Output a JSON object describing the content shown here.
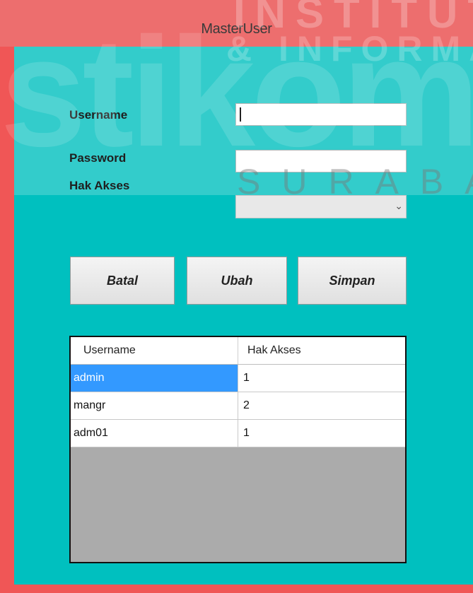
{
  "window": {
    "title": "MasterUser"
  },
  "watermark": {
    "brand": "stikom",
    "top": "INSTITUT B",
    "middle": "& INFORMA",
    "bottom": "SURABAYA"
  },
  "form": {
    "username_label": "Username",
    "username_value": "",
    "password_label": "Password",
    "password_value": "",
    "hak_akses_label": "Hak Akses",
    "hak_akses_value": ""
  },
  "buttons": {
    "batal": "Batal",
    "ubah": "Ubah",
    "simpan": "Simpan"
  },
  "grid": {
    "columns": [
      "Username",
      "Hak Akses"
    ],
    "rows": [
      {
        "username": "admin",
        "hak_akses": "1",
        "selected": true
      },
      {
        "username": "mangr",
        "hak_akses": "2"
      },
      {
        "username": "adm01",
        "hak_akses": "1"
      }
    ]
  },
  "colors": {
    "frame": "#f05656",
    "client": "#00c0bf",
    "selection": "#3399ff"
  }
}
